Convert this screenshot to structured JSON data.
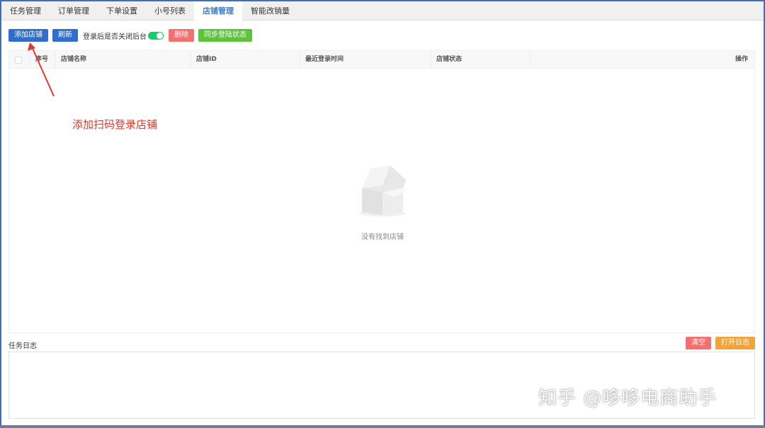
{
  "tabs": [
    {
      "label": "任务管理"
    },
    {
      "label": "订单管理"
    },
    {
      "label": "下单设置"
    },
    {
      "label": "小号列表"
    },
    {
      "label": "店铺管理"
    },
    {
      "label": "智能改销量"
    }
  ],
  "active_tab": "店铺管理",
  "toolbar": {
    "add_label": "添加店铺",
    "refresh_label": "刷新",
    "toggle_label": "登录后是否关闭后台",
    "toggle_on": true,
    "delete_label": "删除",
    "sync_label": "同步登陆状态"
  },
  "table": {
    "columns": [
      "序号",
      "店铺名称",
      "店铺ID",
      "最近登录时间",
      "店铺状态",
      "操作"
    ],
    "rows": [],
    "empty_text": "没有找到店铺"
  },
  "annotation": {
    "text": "添加扫码登录店铺"
  },
  "log": {
    "label": "任务日志",
    "clear_label": "清空",
    "open_label": "打开日志"
  },
  "watermark": "知乎 @哆哆电商助手",
  "colors": {
    "primary": "#2f6fcb",
    "danger": "#f46f6f",
    "success": "#5cc33b",
    "warning": "#f0a43a",
    "annotation": "#e0392b",
    "toggle_on": "#13ce66"
  },
  "icons": {
    "empty": "empty-box-icon",
    "annotation": "red-arrow-icon"
  }
}
